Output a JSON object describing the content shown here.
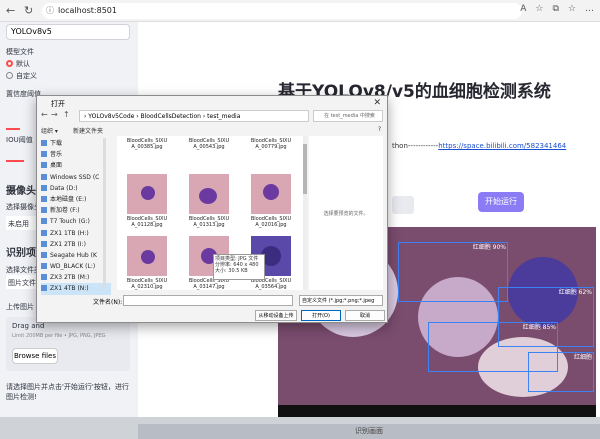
{
  "browser": {
    "url": "localhost:8501",
    "back": "←",
    "refresh": "↻",
    "info": "ⓘ",
    "icons": [
      "A",
      "☆",
      "⧉",
      "☆",
      "…"
    ]
  },
  "sidebar": {
    "model_select": "YOLOv8v5",
    "model_file_label": "模型文件",
    "radio_default": "默认",
    "radio_custom": "自定义",
    "conf_label": "置信度阈值",
    "iou_label": "IOU阈值",
    "camera_heading": "摄像头",
    "camera_select_label": "选择摄像头",
    "camera_unused": "未启用",
    "recognition_heading": "识别项",
    "file_type_label": "选择文件类",
    "image_file": "图片文件",
    "upload_label": "上传图片",
    "drag_text": "Drag and",
    "limit_text": "Limit 200MB per file • JPG, PNG, JPEG",
    "browse_button": "Browse files",
    "hint_text": "请选择图片并点击'开始运行'按钮，进行图片检测!"
  },
  "main": {
    "title": "基于YOLOv8/v5的血细胞检测系统",
    "author_prefix": "thon------------",
    "link": "https://space.bilibili.com/582341464",
    "run_button": "开始运行",
    "bottom_label": "识别画面"
  },
  "detections": [
    {
      "label": "红细胞 90%"
    },
    {
      "label": "红细胞 62%"
    },
    {
      "label": "红细胞 85%"
    },
    {
      "label": "红细胞"
    }
  ],
  "dialog": {
    "title": "打开",
    "close": "✕",
    "address": "› YOLOv8v5Code › BloodCellsDetection › test_media",
    "search_placeholder": "在 test_media 中搜索",
    "organize": "组织 ▾",
    "new_folder": "新建文件夹",
    "tree": [
      "下载",
      "音乐",
      "桌面",
      "Windows SSD (C",
      "Data (D:)",
      "本地磁盘 (E:)",
      "新加卷 (F:)",
      "T7 Touch (G:)",
      "ZX1 1TB (H:)",
      "ZX1 2TB (I:)",
      "Seagate Hub (K",
      "WD_BLACK (L:)",
      "ZX3 2TB (M:)",
      "ZX1 4TB (N:)"
    ],
    "files": [
      "BloodCells_SIXU A_00385.jpg",
      "BloodCells_SIXU A_00543.jpg",
      "BloodCells_SIXU A_00779.jpg",
      "BloodCells_SIXU A_01128.jpg",
      "BloodCells_SIXU A_01313.jpg",
      "BloodCells_SIXU A_02016.jpg",
      "BloodCells_SIXU A_02310.jpg",
      "BloodCells_SIXU A_03147.jpg",
      "BloodCells_SIXU A_03564.jpg"
    ],
    "preview_text": "选择要预览的文件。",
    "filename_label": "文件名(N):",
    "filter": "自定义文件 (*.jpg;*.png;*.jpeg",
    "btn_mobile": "从移动设备上传",
    "btn_open": "打开(O)",
    "btn_cancel": "取消",
    "tooltip": "项目类型: JPG 文件 分辨率: 640 x 480 大小: 30.5 KB"
  }
}
